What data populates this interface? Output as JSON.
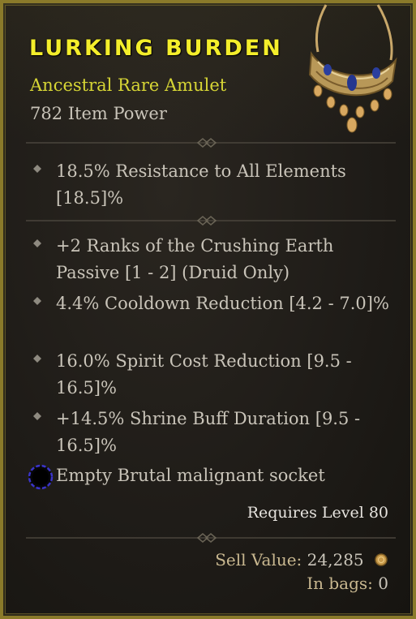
{
  "item": {
    "name": "LURKING BURDEN",
    "type_line": "Ancestral Rare Amulet",
    "item_power": "782 Item Power",
    "image_icon": "amulet-icon"
  },
  "implicit": [
    {
      "text": "18.5% Resistance to All Elements [18.5]%"
    }
  ],
  "affixes": [
    {
      "text": "+2 Ranks of the Crushing Earth Passive [1 - 2] (Druid Only)"
    },
    {
      "text": "4.4% Cooldown Reduction [4.2 - 7.0]%"
    },
    {
      "text": "16.0% Spirit Cost Reduction [9.5 - 16.5]%"
    },
    {
      "text": "+14.5% Shrine Buff Duration [9.5 - 16.5]%"
    }
  ],
  "socket": {
    "text": "Empty Brutal malignant socket",
    "icon": "malignant-socket-icon"
  },
  "requirement": "Requires Level 80",
  "sell": {
    "label": "Sell Value:",
    "value": "24,285",
    "icon": "gold-coin-icon"
  },
  "bags": {
    "label": "In bags:",
    "value": "0"
  },
  "colors": {
    "title": "#f4ee2b",
    "rarity": "#d7d635",
    "body_text": "#c9c4b9",
    "border": "#8a7a2a",
    "socket_ring": "#3a34c9"
  }
}
